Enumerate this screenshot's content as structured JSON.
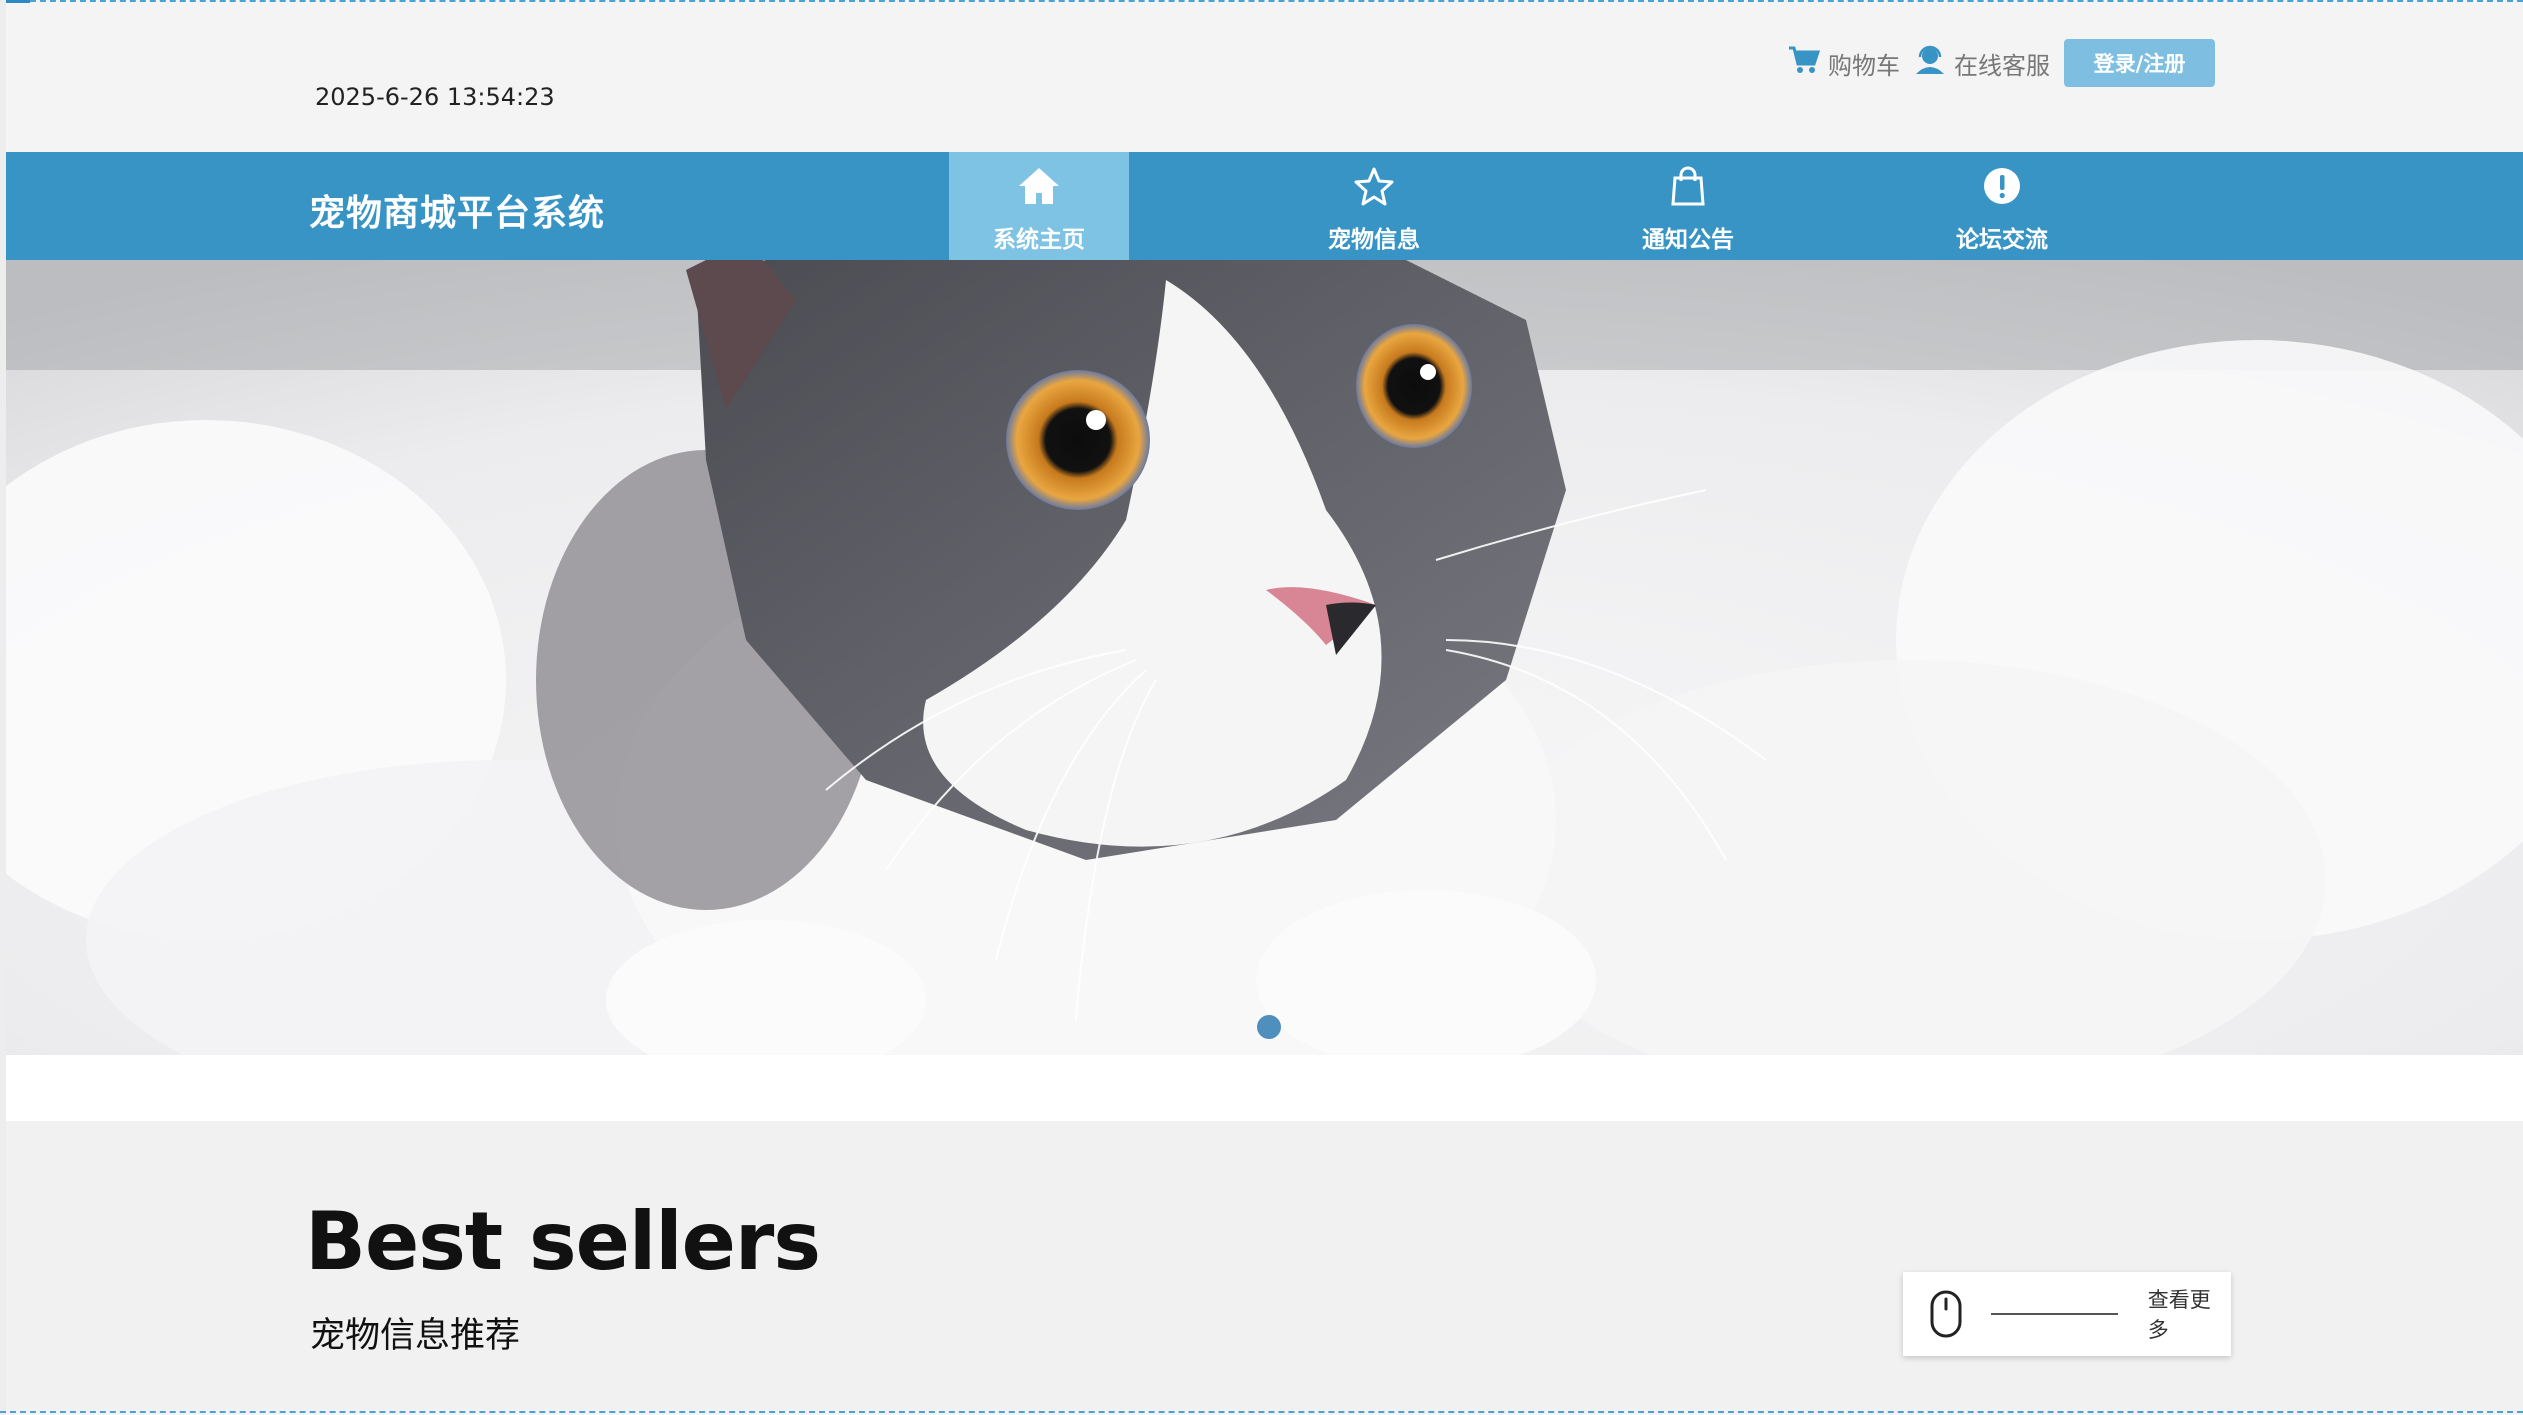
{
  "header": {
    "datetime": "2025-6-26 13:54:23",
    "cart_label": "购物车",
    "service_label": "在线客服",
    "login_label": "登录/注册"
  },
  "nav": {
    "brand": "宠物商城平台系统",
    "items": [
      {
        "label": "系统主页",
        "icon": "home-icon",
        "active": true
      },
      {
        "label": "宠物信息",
        "icon": "star-icon",
        "active": false
      },
      {
        "label": "通知公告",
        "icon": "shopping-bag-icon",
        "active": false
      },
      {
        "label": "论坛交流",
        "icon": "exclamation-circle-icon",
        "active": false
      }
    ]
  },
  "carousel": {
    "image": "gray-and-white kitten lying on white fur blanket",
    "slide_count": 1,
    "active_slide": 1
  },
  "best_sellers": {
    "title": "Best sellers",
    "subtitle": "宠物信息推荐",
    "more_label": "查看更多"
  },
  "colors": {
    "nav_bg": "#3794c5",
    "nav_active": "#7ec2e4",
    "login_bg": "#7ebfe1",
    "dot": "#4f8fbe"
  }
}
